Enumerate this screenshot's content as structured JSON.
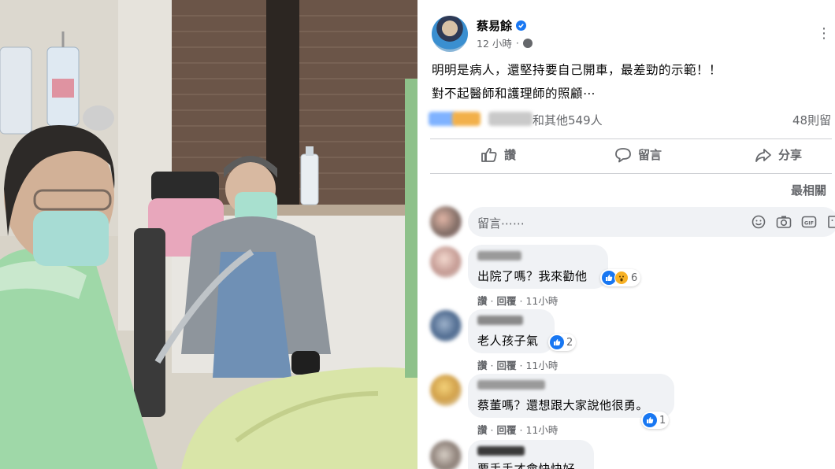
{
  "post": {
    "author": "蔡易餘",
    "time": "12 小時",
    "time_sep": "·",
    "text_line1": "明明是病人，還堅持要自己開車，最差勁的示範！！",
    "text_line2": "對不起醫師和護理師的照顧⋯",
    "reactors_suffix": "和其他549人",
    "comments_count": "48則留",
    "actions": {
      "like": "讚",
      "comment": "留言",
      "share": "分享"
    },
    "sort_label": "最相關",
    "composer_placeholder": "留言⋯⋯"
  },
  "comments": [
    {
      "text": "出院了嗎？我來勸他",
      "reactions": "6",
      "like": "讚",
      "reply": "回覆",
      "time": "11小時",
      "sep": "·"
    },
    {
      "text": "老人孩子氣",
      "reactions": "2",
      "like": "讚",
      "reply": "回覆",
      "time": "11小時",
      "sep": "·"
    },
    {
      "text": "蔡董嗎？還想跟大家說他很勇。",
      "reactions": "1",
      "like": "讚",
      "reply": "回覆",
      "time": "11小時",
      "sep": "·"
    },
    {
      "text": "要手手才會快快好"
    }
  ],
  "colors": {
    "facebook_blue": "#1877f2",
    "secondary_text": "#65676b",
    "bubble_bg": "#f0f2f5",
    "divider": "#ced0d4"
  },
  "icons": [
    "verified-icon",
    "globe-icon",
    "more-icon",
    "like-icon",
    "comment-icon",
    "share-icon",
    "emoji-icon",
    "camera-icon",
    "gif-icon",
    "sticker-icon",
    "like-reaction-icon",
    "wow-reaction-icon"
  ]
}
